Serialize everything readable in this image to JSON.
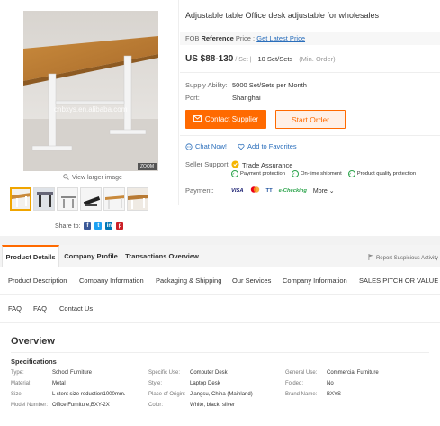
{
  "product": {
    "title": "Adjustable table Office desk adjustable for wholesales",
    "watermark": "cnbxys.en.alibaba.com",
    "zoom_label": "ZOOM",
    "view_larger": "View larger image",
    "share_label": "Share to:",
    "share_icons": [
      "facebook-icon",
      "twitter-icon",
      "linkedin-icon",
      "pinterest-icon"
    ]
  },
  "pricing": {
    "fob_label": "FOB",
    "fob_reference": "Reference",
    "fob_suffix": "Price :",
    "fob_link": "Get Latest Price",
    "price": "US $88-130",
    "unit": "/ Set",
    "moq": "10 Set/Sets",
    "moq_note": "(Min. Order)"
  },
  "details": {
    "supply_label": "Supply Ability:",
    "supply_value": "5000 Set/Sets per Month",
    "port_label": "Port:",
    "port_value": "Shanghai"
  },
  "buttons": {
    "contact": "Contact Supplier",
    "order": "Start Order"
  },
  "actions": {
    "chat": "Chat Now!",
    "favorites": "Add to Favorites"
  },
  "support": {
    "label": "Seller Support:",
    "trade": "Trade Assurance",
    "guarantees": [
      "Payment protection",
      "On-time shipment",
      "Product quality protection"
    ]
  },
  "payment": {
    "label": "Payment:",
    "methods": [
      "VISA",
      "mastercard-icon",
      "TT",
      "e-Checking"
    ],
    "more": "More"
  },
  "tabs": [
    "Product Details",
    "Company Profile",
    "Transactions Overview"
  ],
  "report": "Report Suspicious Activity",
  "subnav_row1": [
    "Product Description",
    "Company Information",
    "Packaging & Shipping",
    "Our Services",
    "Company Information",
    "SALES PITCH OR VALUE"
  ],
  "subnav_row2": [
    "FAQ",
    "FAQ",
    "Contact Us"
  ],
  "overview": {
    "heading": "Overview",
    "spec_title": "Specifications",
    "rows": [
      [
        [
          "Type:",
          "School Furniture"
        ],
        [
          "Specific Use:",
          "Computer Desk"
        ],
        [
          "General Use:",
          "Commercial Furniture"
        ]
      ],
      [
        [
          "Material:",
          "Metal"
        ],
        [
          "Style:",
          "Laptop Desk"
        ],
        [
          "Folded:",
          "No"
        ]
      ],
      [
        [
          "Size:",
          "L stent size reduction1000mm."
        ],
        [
          "Place of Origin:",
          "Jiangsu, China (Mainland)"
        ],
        [
          "Brand Name:",
          "BXYS"
        ]
      ],
      [
        [
          "Model Number:",
          "Office Furniture,BXY-2X"
        ],
        [
          "Color:",
          "White, black, silver"
        ],
        [
          "",
          ""
        ]
      ]
    ]
  },
  "colors": {
    "accent": "#ff6a00",
    "link": "#2a6ebb",
    "trade_gold": "#f5b400",
    "guarantee_green": "#2aa34a"
  }
}
